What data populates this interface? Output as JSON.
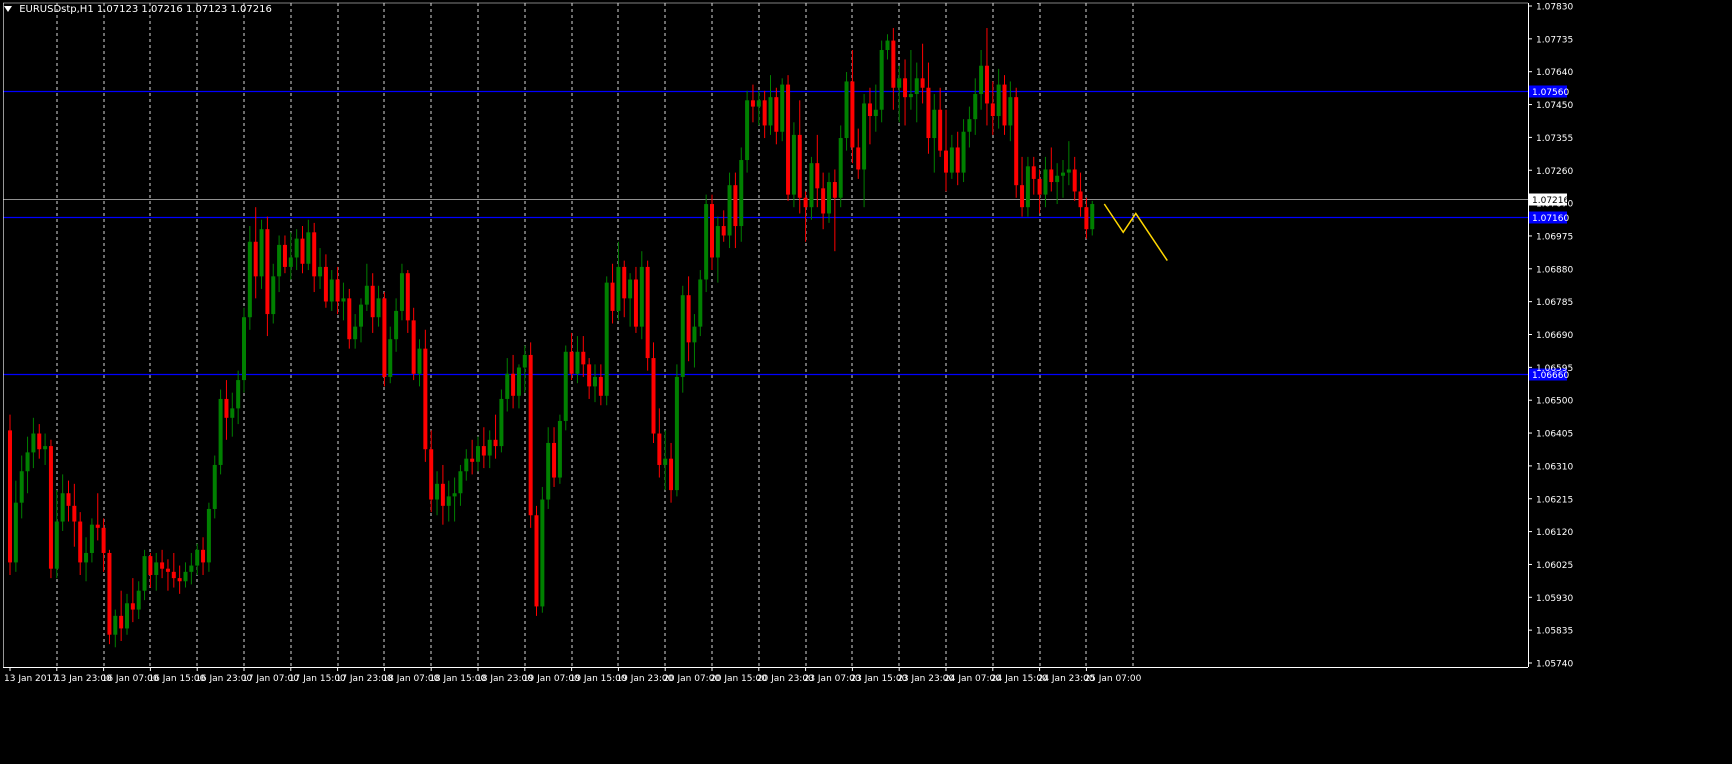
{
  "header": {
    "symbol": "EURUSDstp,H1",
    "ohlc": "1.07123 1.07216 1.07123 1.07216"
  },
  "colors": {
    "background": "#000000",
    "bull": "#008000",
    "bear": "#ff0000",
    "grid": "#ffffff",
    "level_line": "#0000ff",
    "projection": "#ffd700",
    "current_price_line": "#c0c0c0"
  },
  "icons": [
    "dropdown-triangle-icon"
  ],
  "chart_data": {
    "type": "candlestick",
    "timeframe": "H1",
    "ylim": [
      1.0574,
      1.0783
    ],
    "y_ticks": [
      "1.07830",
      "1.07735",
      "1.07640",
      "1.07450",
      "1.07355",
      "1.07260",
      "1.07070",
      "1.06975",
      "1.06880",
      "1.06785",
      "1.06690",
      "1.06595",
      "1.06500",
      "1.06405",
      "1.06310",
      "1.06215",
      "1.06120",
      "1.06025",
      "1.05930",
      "1.05835",
      "1.05740"
    ],
    "x_ticks": [
      "13 Jan 2017",
      "13 Jan 23:00",
      "16 Jan 07:00",
      "16 Jan 15:00",
      "16 Jan 23:00",
      "17 Jan 07:00",
      "17 Jan 15:00",
      "17 Jan 23:00",
      "18 Jan 07:00",
      "18 Jan 15:00",
      "18 Jan 23:00",
      "19 Jan 07:00",
      "19 Jan 15:00",
      "19 Jan 23:00",
      "20 Jan 07:00",
      "20 Jan 15:00",
      "20 Jan 23:00",
      "23 Jan 07:00",
      "23 Jan 15:00",
      "23 Jan 23:00",
      "24 Jan 07:00",
      "24 Jan 15:00",
      "24 Jan 23:00",
      "25 Jan 07:00"
    ],
    "current_price": "1.07216",
    "horizontal_levels": [
      {
        "price": 1.0756,
        "label": "1.07560"
      },
      {
        "price": 1.0716,
        "label": "1.07160"
      },
      {
        "price": 1.0666,
        "label": "1.06660"
      }
    ],
    "projection": [
      [
        1.072,
        0
      ],
      [
        1.0711,
        3
      ],
      [
        1.0717,
        5
      ],
      [
        1.0702,
        10
      ]
    ],
    "candles": [
      [
        1.0648,
        1.0653,
        1.0602,
        1.0606
      ],
      [
        1.0606,
        1.0632,
        1.0603,
        1.0625
      ],
      [
        1.0625,
        1.064,
        1.062,
        1.0635
      ],
      [
        1.0635,
        1.0646,
        1.0628,
        1.0641
      ],
      [
        1.0641,
        1.0652,
        1.0636,
        1.0647
      ],
      [
        1.0647,
        1.065,
        1.0639,
        1.0642
      ],
      [
        1.0642,
        1.0647,
        1.0637,
        1.0643
      ],
      [
        1.0643,
        1.0645,
        1.0601,
        1.0604
      ],
      [
        1.0604,
        1.0629,
        1.0601,
        1.0619
      ],
      [
        1.0619,
        1.0634,
        1.0616,
        1.0628
      ],
      [
        1.0628,
        1.0632,
        1.0619,
        1.0624
      ],
      [
        1.0624,
        1.0631,
        1.0611,
        1.0619
      ],
      [
        1.0619,
        1.0622,
        1.0602,
        1.0606
      ],
      [
        1.0606,
        1.0614,
        1.06,
        1.0609
      ],
      [
        1.0609,
        1.062,
        1.0606,
        1.0618
      ],
      [
        1.0618,
        1.0628,
        1.0613,
        1.0617
      ],
      [
        1.0617,
        1.062,
        1.0603,
        1.0609
      ],
      [
        1.0609,
        1.061,
        1.058,
        1.0583
      ],
      [
        1.0583,
        1.0591,
        1.0579,
        1.0589
      ],
      [
        1.0589,
        1.0597,
        1.0581,
        1.0585
      ],
      [
        1.0585,
        1.0596,
        1.0583,
        1.0593
      ],
      [
        1.0593,
        1.0601,
        1.0587,
        1.0591
      ],
      [
        1.0591,
        1.06,
        1.0588,
        1.0597
      ],
      [
        1.0597,
        1.061,
        1.0594,
        1.0608
      ],
      [
        1.0608,
        1.0609,
        1.0598,
        1.0602
      ],
      [
        1.0602,
        1.0609,
        1.0597,
        1.0606
      ],
      [
        1.0606,
        1.061,
        1.0601,
        1.0604
      ],
      [
        1.0604,
        1.0607,
        1.0597,
        1.0603
      ],
      [
        1.0603,
        1.0609,
        1.0598,
        1.0601
      ],
      [
        1.0601,
        1.0605,
        1.0596,
        1.06
      ],
      [
        1.06,
        1.0606,
        1.0598,
        1.0603
      ],
      [
        1.0603,
        1.0609,
        1.0599,
        1.0605
      ],
      [
        1.0605,
        1.0612,
        1.0602,
        1.061
      ],
      [
        1.061,
        1.0614,
        1.0602,
        1.0606
      ],
      [
        1.0606,
        1.0625,
        1.0603,
        1.0623
      ],
      [
        1.0623,
        1.064,
        1.062,
        1.0637
      ],
      [
        1.0637,
        1.0661,
        1.0634,
        1.0658
      ],
      [
        1.0658,
        1.0664,
        1.0645,
        1.0652
      ],
      [
        1.0652,
        1.066,
        1.0646,
        1.0655
      ],
      [
        1.0655,
        1.0667,
        1.065,
        1.0664
      ],
      [
        1.0664,
        1.0687,
        1.066,
        1.0684
      ],
      [
        1.0684,
        1.0713,
        1.068,
        1.0708
      ],
      [
        1.0708,
        1.0719,
        1.069,
        1.0697
      ],
      [
        1.0697,
        1.0715,
        1.0693,
        1.0712
      ],
      [
        1.0712,
        1.0716,
        1.0678,
        1.0685
      ],
      [
        1.0685,
        1.0701,
        1.0682,
        1.0697
      ],
      [
        1.0697,
        1.071,
        1.0692,
        1.0707
      ],
      [
        1.0707,
        1.071,
        1.0698,
        1.07
      ],
      [
        1.07,
        1.0711,
        1.0696,
        1.0703
      ],
      [
        1.0703,
        1.0712,
        1.0699,
        1.0709
      ],
      [
        1.0709,
        1.0713,
        1.0698,
        1.0701
      ],
      [
        1.0701,
        1.0715,
        1.0699,
        1.0711
      ],
      [
        1.0711,
        1.0714,
        1.0692,
        1.0697
      ],
      [
        1.0697,
        1.0706,
        1.0693,
        1.07
      ],
      [
        1.07,
        1.0704,
        1.0687,
        1.0689
      ],
      [
        1.0689,
        1.0699,
        1.0686,
        1.0696
      ],
      [
        1.0696,
        1.07,
        1.0685,
        1.0689
      ],
      [
        1.0689,
        1.0695,
        1.0683,
        1.069
      ],
      [
        1.069,
        1.0693,
        1.0674,
        1.0677
      ],
      [
        1.0677,
        1.0685,
        1.0674,
        1.0681
      ],
      [
        1.0681,
        1.069,
        1.0676,
        1.0688
      ],
      [
        1.0688,
        1.0701,
        1.0686,
        1.0694
      ],
      [
        1.0694,
        1.0698,
        1.0679,
        1.0684
      ],
      [
        1.0684,
        1.0694,
        1.0681,
        1.069
      ],
      [
        1.069,
        1.0692,
        1.0662,
        1.0665
      ],
      [
        1.0665,
        1.0681,
        1.0663,
        1.0677
      ],
      [
        1.0677,
        1.069,
        1.0673,
        1.0686
      ],
      [
        1.0686,
        1.0701,
        1.0683,
        1.0698
      ],
      [
        1.0698,
        1.0699,
        1.0679,
        1.0683
      ],
      [
        1.0683,
        1.0687,
        1.0664,
        1.0666
      ],
      [
        1.0666,
        1.0677,
        1.0662,
        1.0674
      ],
      [
        1.0674,
        1.068,
        1.0638,
        1.0642
      ],
      [
        1.0642,
        1.0648,
        1.0622,
        1.0626
      ],
      [
        1.0626,
        1.0635,
        1.0621,
        1.0631
      ],
      [
        1.0631,
        1.0637,
        1.0618,
        1.0624
      ],
      [
        1.0624,
        1.0632,
        1.0619,
        1.0627
      ],
      [
        1.0627,
        1.0633,
        1.0619,
        1.0628
      ],
      [
        1.0628,
        1.0637,
        1.0624,
        1.0635
      ],
      [
        1.0635,
        1.0642,
        1.0632,
        1.0639
      ],
      [
        1.0639,
        1.0645,
        1.0634,
        1.0638
      ],
      [
        1.0638,
        1.0646,
        1.0635,
        1.0643
      ],
      [
        1.0643,
        1.0649,
        1.0636,
        1.064
      ],
      [
        1.064,
        1.0648,
        1.0636,
        1.0645
      ],
      [
        1.0645,
        1.0653,
        1.0639,
        1.0643
      ],
      [
        1.0643,
        1.0661,
        1.0641,
        1.0658
      ],
      [
        1.0658,
        1.0671,
        1.0654,
        1.0666
      ],
      [
        1.0666,
        1.0672,
        1.0655,
        1.0659
      ],
      [
        1.0659,
        1.0669,
        1.0655,
        1.0668
      ],
      [
        1.0668,
        1.0675,
        1.066,
        1.0672
      ],
      [
        1.0672,
        1.0676,
        1.0617,
        1.0621
      ],
      [
        1.0621,
        1.0624,
        1.0589,
        1.0592
      ],
      [
        1.0592,
        1.063,
        1.059,
        1.0626
      ],
      [
        1.0626,
        1.0649,
        1.0623,
        1.0644
      ],
      [
        1.0644,
        1.0649,
        1.063,
        1.0633
      ],
      [
        1.0633,
        1.0653,
        1.0631,
        1.0651
      ],
      [
        1.0651,
        1.0675,
        1.0648,
        1.0673
      ],
      [
        1.0673,
        1.0679,
        1.0664,
        1.0666
      ],
      [
        1.0666,
        1.0678,
        1.0663,
        1.0673
      ],
      [
        1.0673,
        1.0678,
        1.0665,
        1.0669
      ],
      [
        1.0669,
        1.0671,
        1.0658,
        1.0662
      ],
      [
        1.0662,
        1.0669,
        1.0657,
        1.0665
      ],
      [
        1.0665,
        1.0669,
        1.0656,
        1.0659
      ],
      [
        1.0659,
        1.0697,
        1.0656,
        1.0695
      ],
      [
        1.0695,
        1.0701,
        1.0682,
        1.0686
      ],
      [
        1.0686,
        1.0708,
        1.0683,
        1.07
      ],
      [
        1.07,
        1.0702,
        1.0684,
        1.069
      ],
      [
        1.069,
        1.0698,
        1.0681,
        1.0696
      ],
      [
        1.0696,
        1.07,
        1.0679,
        1.0681
      ],
      [
        1.0681,
        1.0705,
        1.0677,
        1.07
      ],
      [
        1.07,
        1.0702,
        1.0667,
        1.0671
      ],
      [
        1.0671,
        1.0676,
        1.0644,
        1.0647
      ],
      [
        1.0647,
        1.0655,
        1.0633,
        1.0637
      ],
      [
        1.0637,
        1.0648,
        1.0629,
        1.0639
      ],
      [
        1.0639,
        1.0644,
        1.0625,
        1.0629
      ],
      [
        1.0629,
        1.0669,
        1.0627,
        1.0665
      ],
      [
        1.0665,
        1.0694,
        1.066,
        1.0691
      ],
      [
        1.0691,
        1.0697,
        1.067,
        1.0676
      ],
      [
        1.0676,
        1.0685,
        1.0668,
        1.0681
      ],
      [
        1.0681,
        1.0699,
        1.0678,
        1.0696
      ],
      [
        1.0696,
        1.0723,
        1.0692,
        1.072
      ],
      [
        1.072,
        1.0723,
        1.0699,
        1.0703
      ],
      [
        1.0703,
        1.0716,
        1.0695,
        1.0713
      ],
      [
        1.0713,
        1.0718,
        1.0708,
        1.071
      ],
      [
        1.071,
        1.073,
        1.0706,
        1.0726
      ],
      [
        1.0726,
        1.073,
        1.0706,
        1.0713
      ],
      [
        1.0713,
        1.0738,
        1.0708,
        1.0734
      ],
      [
        1.0734,
        1.0756,
        1.073,
        1.0753
      ],
      [
        1.0753,
        1.0758,
        1.0746,
        1.0751
      ],
      [
        1.0751,
        1.0756,
        1.0745,
        1.0753
      ],
      [
        1.0753,
        1.0756,
        1.0741,
        1.0745
      ],
      [
        1.0745,
        1.0761,
        1.0742,
        1.0754
      ],
      [
        1.0754,
        1.0757,
        1.0739,
        1.0743
      ],
      [
        1.0743,
        1.076,
        1.074,
        1.0758
      ],
      [
        1.0758,
        1.0761,
        1.0721,
        1.0723
      ],
      [
        1.0723,
        1.0746,
        1.0719,
        1.0742
      ],
      [
        1.0742,
        1.0753,
        1.0717,
        1.0722
      ],
      [
        1.0722,
        1.0724,
        1.0708,
        1.0719
      ],
      [
        1.0719,
        1.0735,
        1.0715,
        1.0733
      ],
      [
        1.0733,
        1.0742,
        1.0719,
        1.0725
      ],
      [
        1.0725,
        1.073,
        1.0712,
        1.0717
      ],
      [
        1.0717,
        1.073,
        1.0714,
        1.0727
      ],
      [
        1.0727,
        1.0731,
        1.0705,
        1.0722
      ],
      [
        1.0722,
        1.0745,
        1.0719,
        1.0741
      ],
      [
        1.0741,
        1.0762,
        1.0737,
        1.0759
      ],
      [
        1.0759,
        1.0769,
        1.0733,
        1.0738
      ],
      [
        1.0738,
        1.0744,
        1.0728,
        1.0731
      ],
      [
        1.0731,
        1.0755,
        1.0719,
        1.0752
      ],
      [
        1.0752,
        1.0757,
        1.0739,
        1.0748
      ],
      [
        1.0748,
        1.0758,
        1.0743,
        1.075
      ],
      [
        1.075,
        1.0772,
        1.0746,
        1.0769
      ],
      [
        1.0769,
        1.0774,
        1.0766,
        1.0772
      ],
      [
        1.0772,
        1.0776,
        1.075,
        1.0757
      ],
      [
        1.0757,
        1.0764,
        1.0746,
        1.076
      ],
      [
        1.076,
        1.0766,
        1.0745,
        1.0754
      ],
      [
        1.0754,
        1.0769,
        1.075,
        1.0755
      ],
      [
        1.0755,
        1.0765,
        1.0746,
        1.076
      ],
      [
        1.076,
        1.0771,
        1.0752,
        1.0757
      ],
      [
        1.0757,
        1.0765,
        1.0736,
        1.0741
      ],
      [
        1.0741,
        1.0755,
        1.073,
        1.075
      ],
      [
        1.075,
        1.0757,
        1.0735,
        1.0737
      ],
      [
        1.0737,
        1.075,
        1.0724,
        1.073
      ],
      [
        1.073,
        1.0742,
        1.0728,
        1.0738
      ],
      [
        1.0738,
        1.0743,
        1.0726,
        1.073
      ],
      [
        1.073,
        1.0747,
        1.0727,
        1.0743
      ],
      [
        1.0743,
        1.0751,
        1.0738,
        1.0747
      ],
      [
        1.0747,
        1.076,
        1.0742,
        1.0755
      ],
      [
        1.0755,
        1.0769,
        1.075,
        1.0764
      ],
      [
        1.0764,
        1.0776,
        1.0745,
        1.0752
      ],
      [
        1.0752,
        1.0759,
        1.0742,
        1.0748
      ],
      [
        1.0748,
        1.0763,
        1.0744,
        1.0758
      ],
      [
        1.0758,
        1.0761,
        1.0742,
        1.0745
      ],
      [
        1.0745,
        1.0759,
        1.074,
        1.0754
      ],
      [
        1.0754,
        1.0757,
        1.0722,
        1.0726
      ],
      [
        1.0726,
        1.0735,
        1.0716,
        1.0719
      ],
      [
        1.0719,
        1.0735,
        1.0716,
        1.0732
      ],
      [
        1.0732,
        1.0735,
        1.0723,
        1.0728
      ],
      [
        1.0728,
        1.0731,
        1.0717,
        1.0723
      ],
      [
        1.0723,
        1.0735,
        1.0719,
        1.0731
      ],
      [
        1.0731,
        1.0738,
        1.0724,
        1.0727
      ],
      [
        1.0727,
        1.0733,
        1.072,
        1.0729
      ],
      [
        1.0729,
        1.0734,
        1.0722,
        1.073
      ],
      [
        1.073,
        1.074,
        1.0726,
        1.0731
      ],
      [
        1.0731,
        1.0735,
        1.0721,
        1.0724
      ],
      [
        1.0724,
        1.073,
        1.0716,
        1.0719
      ],
      [
        1.0719,
        1.0722,
        1.0709,
        1.0712
      ],
      [
        1.0712,
        1.0721,
        1.071,
        1.072
      ]
    ]
  }
}
